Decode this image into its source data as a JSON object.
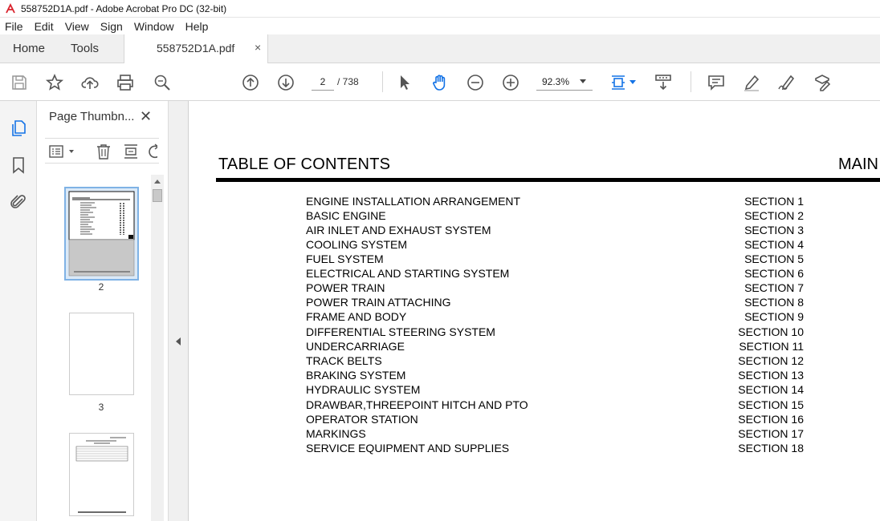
{
  "window": {
    "title": "558752D1A.pdf - Adobe Acrobat Pro DC (32-bit)"
  },
  "menu": [
    "File",
    "Edit",
    "View",
    "Sign",
    "Window",
    "Help"
  ],
  "tabs": {
    "home": "Home",
    "tools": "Tools",
    "document": "558752D1A.pdf",
    "close": "×"
  },
  "toolbar": {
    "current_page": "2",
    "page_total": "/  738",
    "zoom": "92.3%"
  },
  "panel": {
    "title": "Page Thumbn...",
    "close": "✕",
    "thumbnails": [
      {
        "label": "2",
        "selected": true
      },
      {
        "label": "3",
        "selected": false
      },
      {
        "label": "",
        "selected": false
      }
    ]
  },
  "document": {
    "title": "TABLE OF CONTENTS",
    "right_label": "MAIN",
    "entries": [
      {
        "name": "ENGINE INSTALLATION ARRANGEMENT",
        "section": "SECTION 1"
      },
      {
        "name": "BASIC ENGINE",
        "section": "SECTION 2"
      },
      {
        "name": "AIR INLET AND EXHAUST SYSTEM",
        "section": "SECTION 3"
      },
      {
        "name": "COOLING SYSTEM",
        "section": "SECTION 4"
      },
      {
        "name": "FUEL SYSTEM",
        "section": "SECTION 5"
      },
      {
        "name": "ELECTRICAL AND STARTING SYSTEM",
        "section": "SECTION 6"
      },
      {
        "name": "POWER TRAIN",
        "section": "SECTION 7"
      },
      {
        "name": "POWER TRAIN ATTACHING",
        "section": "SECTION 8"
      },
      {
        "name": "FRAME AND BODY",
        "section": "SECTION 9"
      },
      {
        "name": "DIFFERENTIAL STEERING SYSTEM",
        "section": "SECTION 10"
      },
      {
        "name": "UNDERCARRIAGE",
        "section": "SECTION 11"
      },
      {
        "name": "TRACK BELTS",
        "section": "SECTION 12"
      },
      {
        "name": "BRAKING SYSTEM",
        "section": "SECTION 13"
      },
      {
        "name": "HYDRAULIC SYSTEM",
        "section": "SECTION 14"
      },
      {
        "name": "DRAWBAR,THREEPOINT HITCH AND PTO",
        "section": "SECTION 15"
      },
      {
        "name": "OPERATOR STATION",
        "section": "SECTION 16"
      },
      {
        "name": "MARKINGS",
        "section": "SECTION 17"
      },
      {
        "name": "SERVICE EQUIPMENT AND SUPPLIES",
        "section": "SECTION 18"
      }
    ]
  },
  "colors": {
    "accent": "#1473e6",
    "icon": "#555555",
    "panel_bg": "#f4f4f4",
    "acrobat_red": "#d9232d"
  }
}
